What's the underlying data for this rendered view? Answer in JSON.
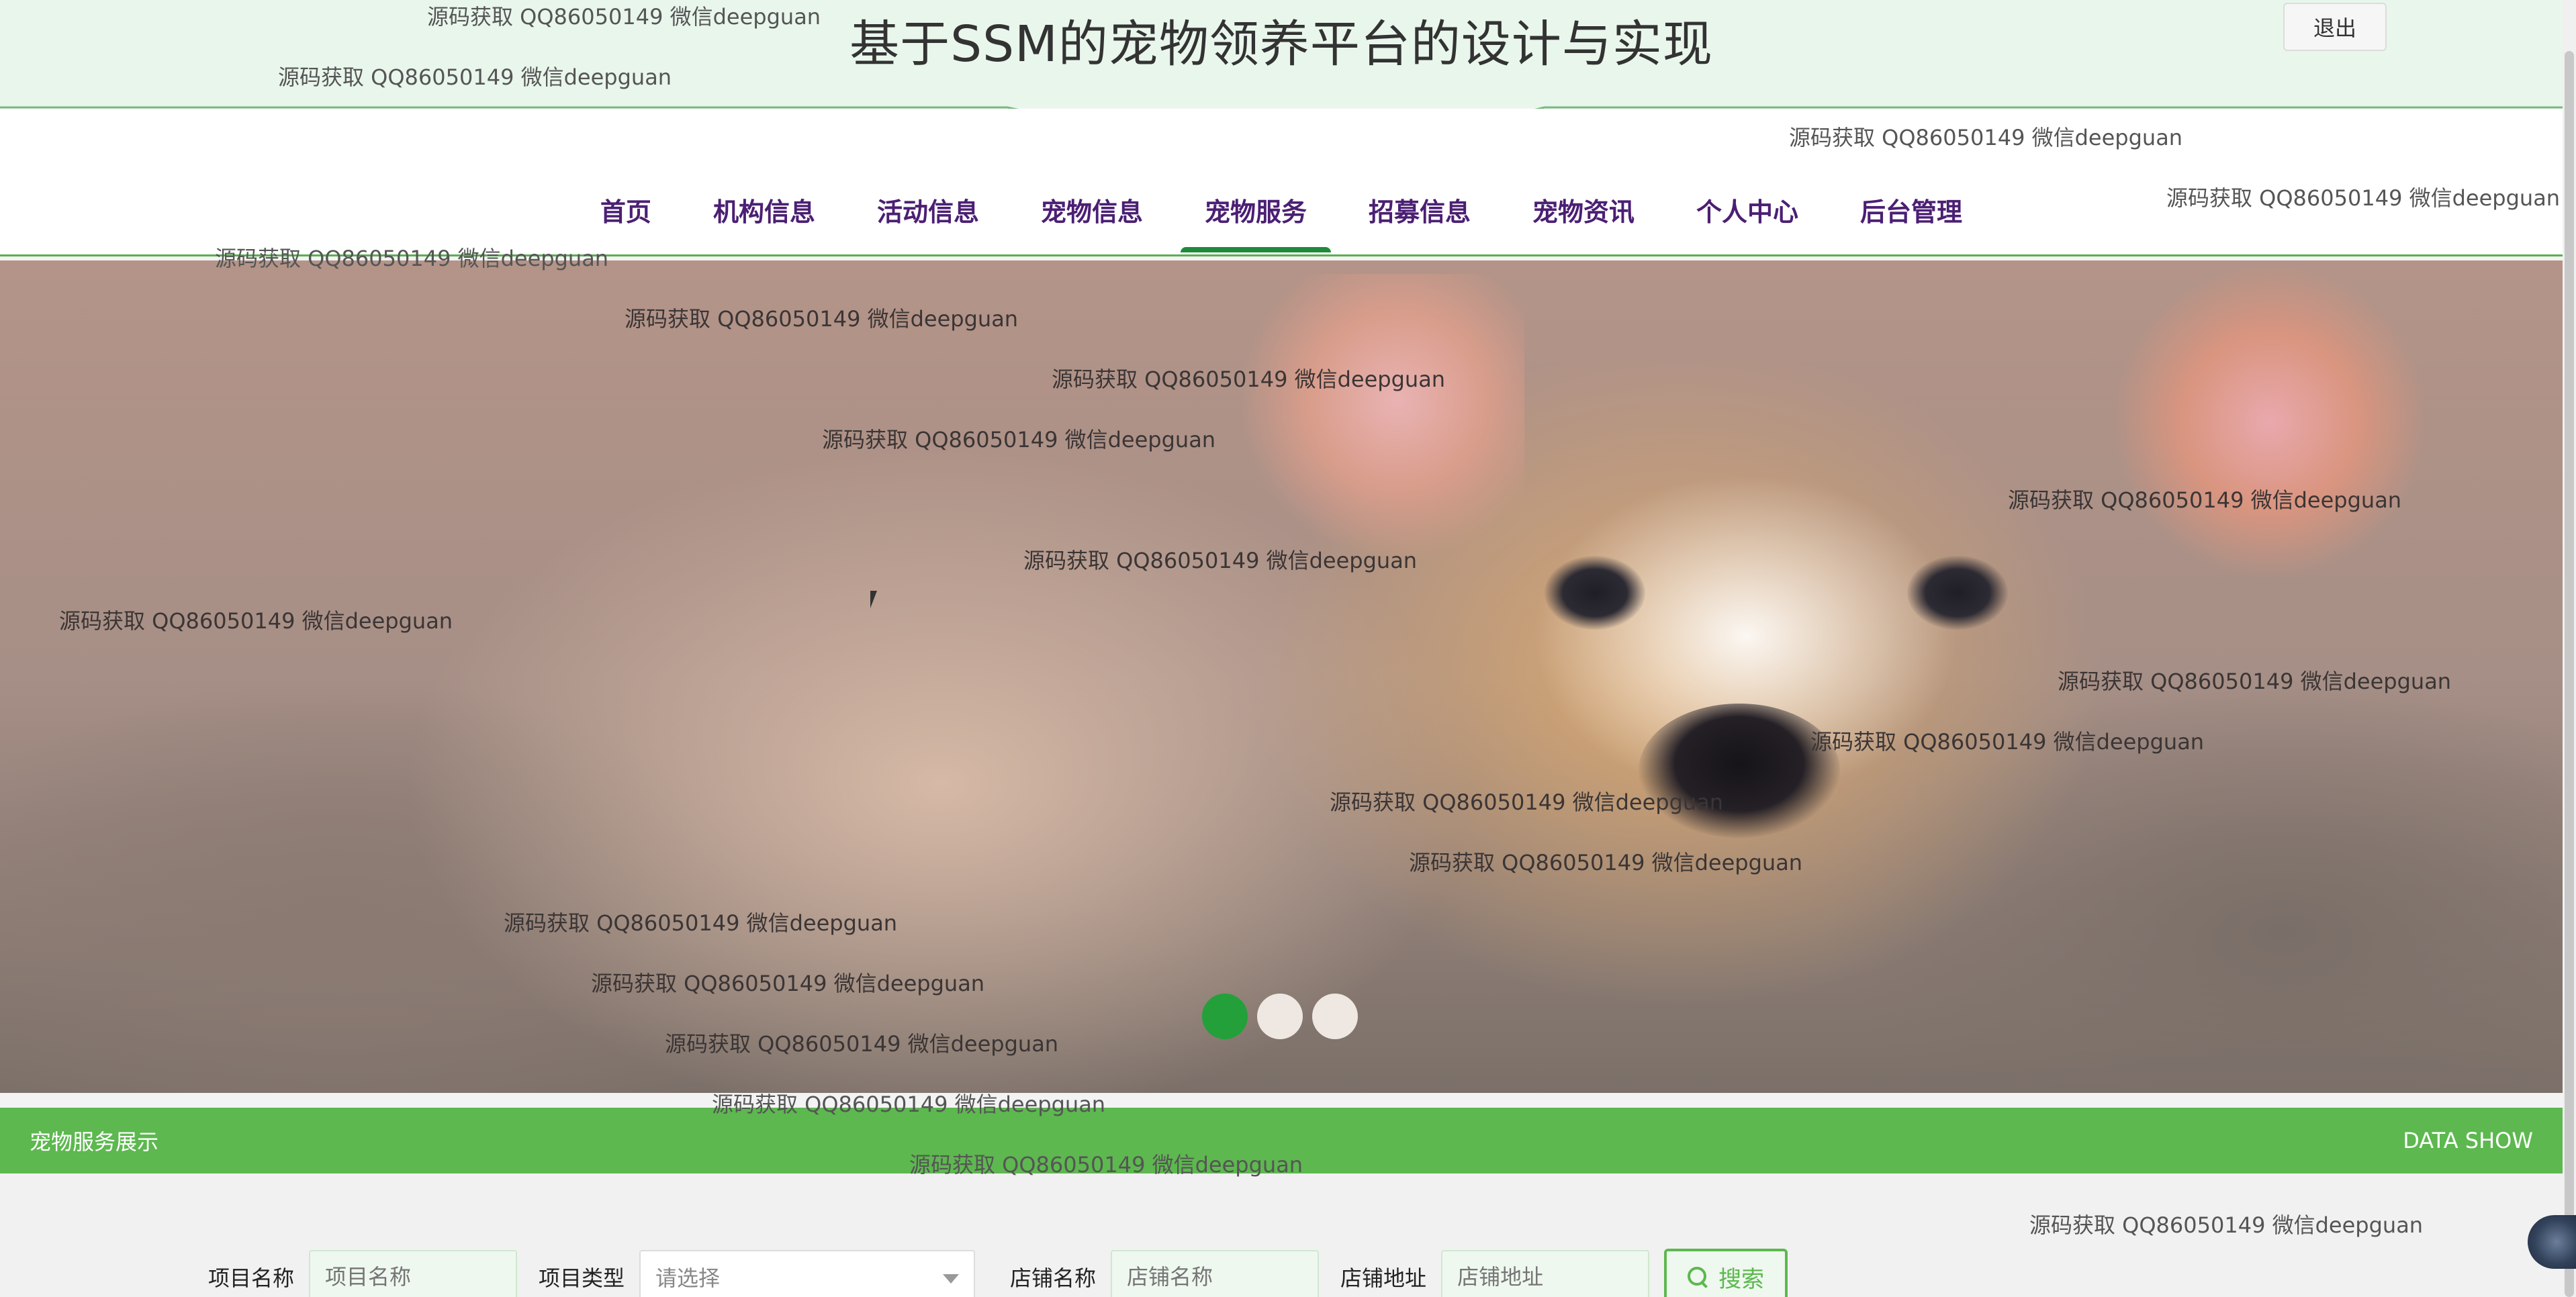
{
  "header": {
    "title": "基于SSM的宠物领养平台的设计与实现",
    "logout_label": "退出"
  },
  "nav": {
    "items": [
      {
        "label": "首页"
      },
      {
        "label": "机构信息"
      },
      {
        "label": "活动信息"
      },
      {
        "label": "宠物信息"
      },
      {
        "label": "宠物服务",
        "active": true
      },
      {
        "label": "招募信息"
      },
      {
        "label": "宠物资讯"
      },
      {
        "label": "个人中心"
      },
      {
        "label": "后台管理"
      }
    ]
  },
  "banner": {
    "dots": 3,
    "active_dot": 1
  },
  "section": {
    "title": "宠物服务展示",
    "right_label": "DATA SHOW"
  },
  "search": {
    "project_name_label": "项目名称",
    "project_name_placeholder": "项目名称",
    "project_type_label": "项目类型",
    "project_type_value": "请选择",
    "shop_name_label": "店铺名称",
    "shop_name_placeholder": "店铺名称",
    "shop_address_label": "店铺地址",
    "shop_address_placeholder": "店铺地址",
    "button_label": "搜索"
  },
  "watermark": {
    "text": "源码获取 QQ86050149 微信deepguan"
  },
  "colors": {
    "accent_green": "#5db84f",
    "nav_text": "#4b1f73",
    "header_bg": "#e9f6ec",
    "active_dot": "#23a03a"
  }
}
